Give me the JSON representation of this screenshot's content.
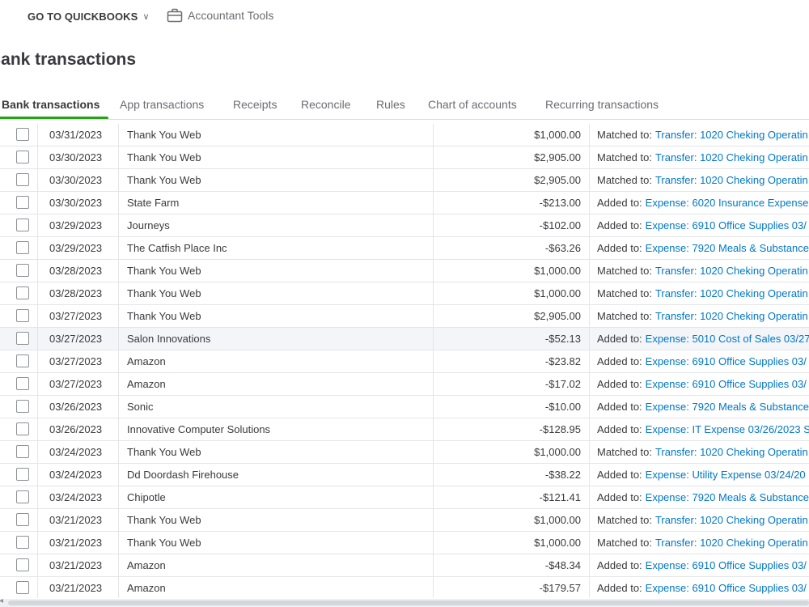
{
  "topbar": {
    "back_icon": "chevron-left-icon",
    "goto_label": "GO TO QUICKBOOKS",
    "accountant_tools_label": "Accountant Tools"
  },
  "page": {
    "title": "Bank transactions"
  },
  "tabs": [
    {
      "label": "Bank transactions",
      "active": true
    },
    {
      "label": "App transactions",
      "active": false
    },
    {
      "label": "Receipts",
      "active": false
    },
    {
      "label": "Reconcile",
      "active": false
    },
    {
      "label": "Rules",
      "active": false
    },
    {
      "label": "Chart of accounts",
      "active": false
    },
    {
      "label": "Recurring transactions",
      "active": false
    }
  ],
  "colors": {
    "accent": "#2ca01c",
    "link": "#0077c5",
    "text": "#393a3d",
    "muted": "#6b6c72"
  },
  "rows": [
    {
      "date": "03/31/2023",
      "description": "Thank You Web",
      "amount": "$1,000.00",
      "status": "Matched to:",
      "link": "Transfer: 1020 Cheking Operatin"
    },
    {
      "date": "03/30/2023",
      "description": "Thank You Web",
      "amount": "$2,905.00",
      "status": "Matched to:",
      "link": "Transfer: 1020 Cheking Operatin"
    },
    {
      "date": "03/30/2023",
      "description": "Thank You Web",
      "amount": "$2,905.00",
      "status": "Matched to:",
      "link": "Transfer: 1020 Cheking Operatin"
    },
    {
      "date": "03/30/2023",
      "description": "State Farm",
      "amount": "-$213.00",
      "status": "Added to:",
      "link": "Expense: 6020 Insurance Expense"
    },
    {
      "date": "03/29/2023",
      "description": "Journeys",
      "amount": "-$102.00",
      "status": "Added to:",
      "link": "Expense: 6910 Office Supplies 03/"
    },
    {
      "date": "03/29/2023",
      "description": "The Catfish Place Inc",
      "amount": "-$63.26",
      "status": "Added to:",
      "link": "Expense: 7920 Meals & Substance"
    },
    {
      "date": "03/28/2023",
      "description": "Thank You Web",
      "amount": "$1,000.00",
      "status": "Matched to:",
      "link": "Transfer: 1020 Cheking Operatin"
    },
    {
      "date": "03/28/2023",
      "description": "Thank You Web",
      "amount": "$1,000.00",
      "status": "Matched to:",
      "link": "Transfer: 1020 Cheking Operatin"
    },
    {
      "date": "03/27/2023",
      "description": "Thank You Web",
      "amount": "$2,905.00",
      "status": "Matched to:",
      "link": "Transfer: 1020 Cheking Operatin"
    },
    {
      "date": "03/27/2023",
      "description": "Salon Innovations",
      "amount": "-$52.13",
      "status": "Added to:",
      "link": "Expense: 5010 Cost of Sales 03/27",
      "highlight": true
    },
    {
      "date": "03/27/2023",
      "description": "Amazon",
      "amount": "-$23.82",
      "status": "Added to:",
      "link": "Expense: 6910 Office Supplies 03/"
    },
    {
      "date": "03/27/2023",
      "description": "Amazon",
      "amount": "-$17.02",
      "status": "Added to:",
      "link": "Expense: 6910 Office Supplies 03/"
    },
    {
      "date": "03/26/2023",
      "description": "Sonic",
      "amount": "-$10.00",
      "status": "Added to:",
      "link": "Expense: 7920 Meals & Substance"
    },
    {
      "date": "03/26/2023",
      "description": "Innovative Computer Solutions",
      "amount": "-$128.95",
      "status": "Added to:",
      "link": "Expense: IT Expense 03/26/2023 S"
    },
    {
      "date": "03/24/2023",
      "description": "Thank You Web",
      "amount": "$1,000.00",
      "status": "Matched to:",
      "link": "Transfer: 1020 Cheking Operatin"
    },
    {
      "date": "03/24/2023",
      "description": "Dd Doordash Firehouse",
      "amount": "-$38.22",
      "status": "Added to:",
      "link": "Expense: Utility Expense 03/24/20"
    },
    {
      "date": "03/24/2023",
      "description": "Chipotle",
      "amount": "-$121.41",
      "status": "Added to:",
      "link": "Expense: 7920 Meals & Substance"
    },
    {
      "date": "03/21/2023",
      "description": "Thank You Web",
      "amount": "$1,000.00",
      "status": "Matched to:",
      "link": "Transfer: 1020 Cheking Operatin"
    },
    {
      "date": "03/21/2023",
      "description": "Thank You Web",
      "amount": "$1,000.00",
      "status": "Matched to:",
      "link": "Transfer: 1020 Cheking Operatin"
    },
    {
      "date": "03/21/2023",
      "description": "Amazon",
      "amount": "-$48.34",
      "status": "Added to:",
      "link": "Expense: 6910 Office Supplies 03/"
    },
    {
      "date": "03/21/2023",
      "description": "Amazon",
      "amount": "-$179.57",
      "status": "Added to:",
      "link": "Expense: 6910 Office Supplies 03/"
    }
  ]
}
